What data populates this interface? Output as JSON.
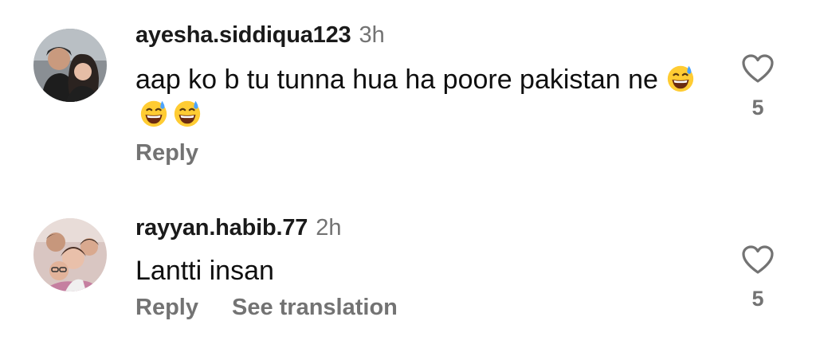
{
  "comments": [
    {
      "username": "ayesha.siddiqua123",
      "time": "3h",
      "text": "aap ko b tu tunna hua ha poore pakistan ne",
      "emojis": [
        "grinning-sweat-emoji",
        "grinning-sweat-emoji",
        "grinning-sweat-emoji"
      ],
      "reply_label": "Reply",
      "likes": "5"
    },
    {
      "username": "rayyan.habib.77",
      "time": "2h",
      "text": "Lantti insan",
      "reply_label": "Reply",
      "translate_label": "See translation",
      "likes": "5"
    }
  ],
  "icons": {
    "like": "heart-outline-icon"
  },
  "colors": {
    "secondary_text": "#737373",
    "primary_text": "#0f0f0f"
  }
}
